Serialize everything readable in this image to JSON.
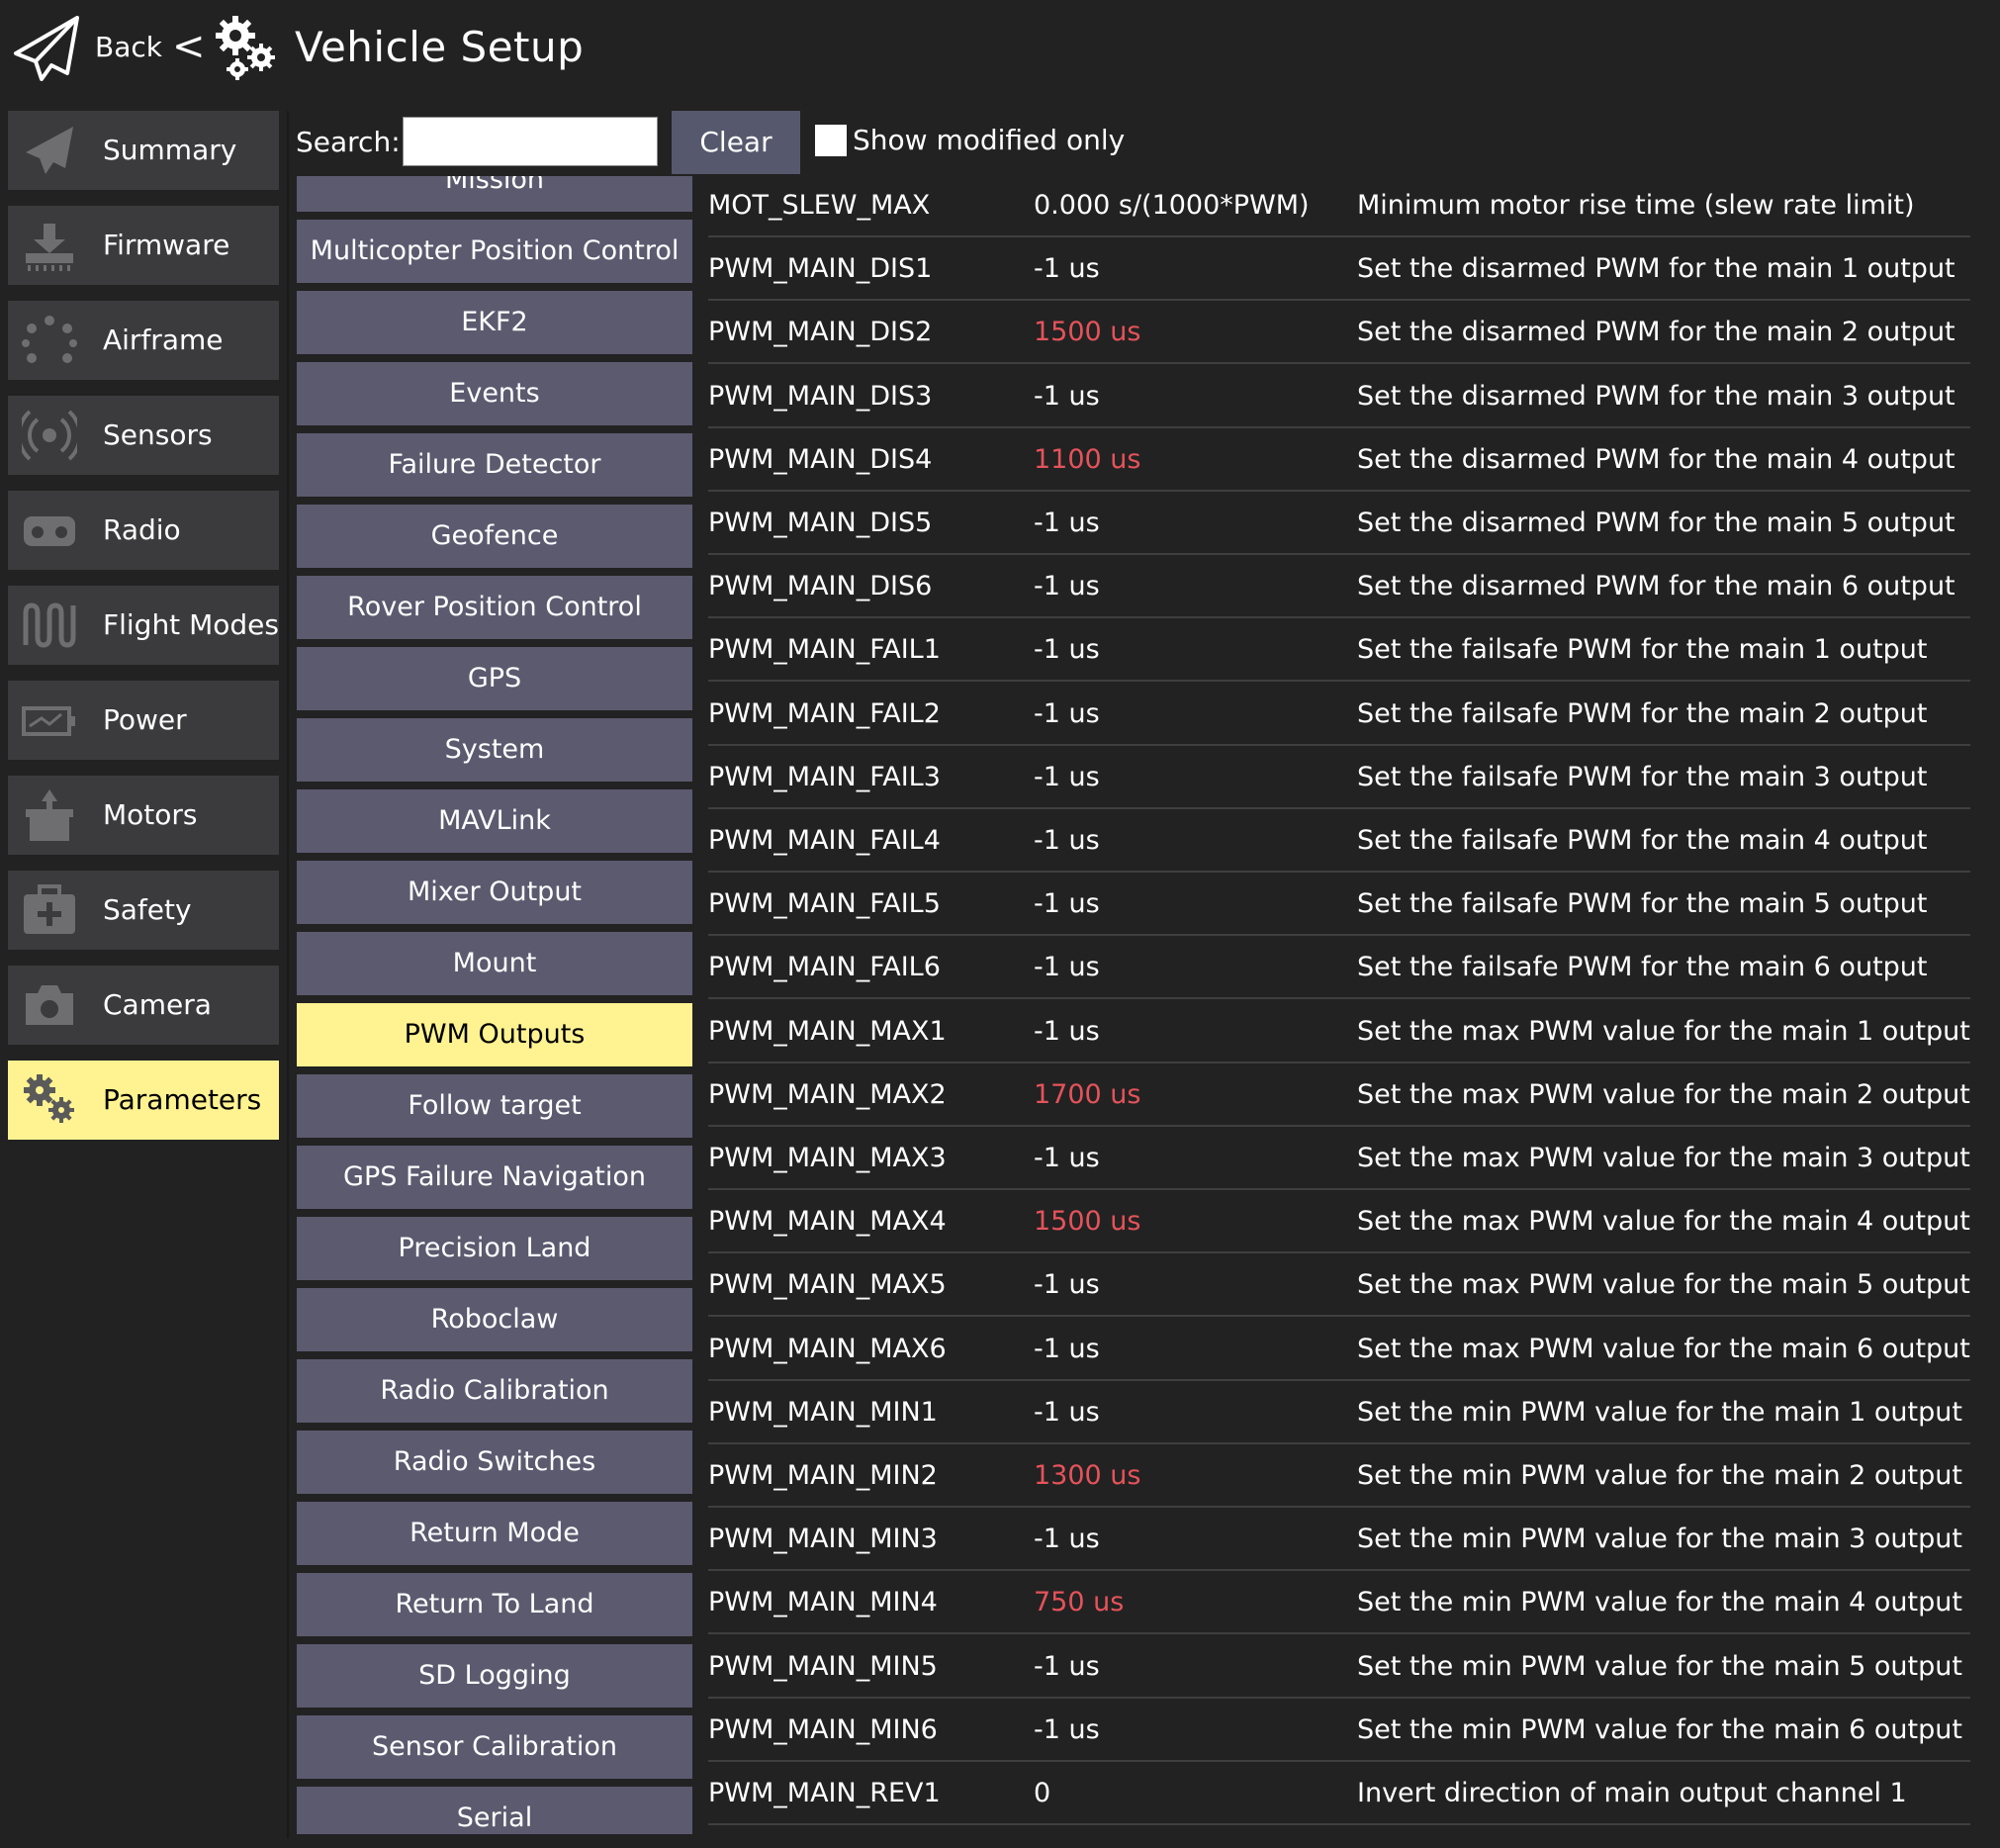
{
  "header": {
    "back_label": "Back",
    "separator": "<",
    "title": "Vehicle Setup"
  },
  "sidebar": {
    "items": [
      {
        "label": "Summary",
        "icon": "paper-plane-icon",
        "active": false
      },
      {
        "label": "Firmware",
        "icon": "download-chip-icon",
        "active": false
      },
      {
        "label": "Airframe",
        "icon": "airframe-dots-icon",
        "active": false
      },
      {
        "label": "Sensors",
        "icon": "radio-waves-icon",
        "active": false
      },
      {
        "label": "Radio",
        "icon": "transmitter-icon",
        "active": false
      },
      {
        "label": "Flight Modes",
        "icon": "waveform-icon",
        "active": false
      },
      {
        "label": "Power",
        "icon": "battery-icon",
        "active": false
      },
      {
        "label": "Motors",
        "icon": "motor-icon",
        "active": false
      },
      {
        "label": "Safety",
        "icon": "first-aid-icon",
        "active": false
      },
      {
        "label": "Camera",
        "icon": "camera-icon",
        "active": false
      },
      {
        "label": "Parameters",
        "icon": "gears-icon",
        "active": true
      }
    ]
  },
  "search": {
    "label": "Search:",
    "value": "",
    "clear_label": "Clear",
    "show_modified_label": "Show modified only",
    "show_modified_checked": false
  },
  "groups": [
    {
      "label": "Mission",
      "active": false
    },
    {
      "label": "Multicopter Position Control",
      "active": false
    },
    {
      "label": "EKF2",
      "active": false
    },
    {
      "label": "Events",
      "active": false
    },
    {
      "label": "Failure Detector",
      "active": false
    },
    {
      "label": "Geofence",
      "active": false
    },
    {
      "label": "Rover Position Control",
      "active": false
    },
    {
      "label": "GPS",
      "active": false
    },
    {
      "label": "System",
      "active": false
    },
    {
      "label": "MAVLink",
      "active": false
    },
    {
      "label": "Mixer Output",
      "active": false
    },
    {
      "label": "Mount",
      "active": false
    },
    {
      "label": "PWM Outputs",
      "active": true
    },
    {
      "label": "Follow target",
      "active": false
    },
    {
      "label": "GPS Failure Navigation",
      "active": false
    },
    {
      "label": "Precision Land",
      "active": false
    },
    {
      "label": "Roboclaw",
      "active": false
    },
    {
      "label": "Radio Calibration",
      "active": false
    },
    {
      "label": "Radio Switches",
      "active": false
    },
    {
      "label": "Return Mode",
      "active": false
    },
    {
      "label": "Return To Land",
      "active": false
    },
    {
      "label": "SD Logging",
      "active": false
    },
    {
      "label": "Sensor Calibration",
      "active": false
    },
    {
      "label": "Serial",
      "active": false
    }
  ],
  "params": [
    {
      "name": "MOT_SLEW_MAX",
      "value": "0.000 s/(1000*PWM)",
      "desc": "Minimum motor rise time (slew rate limit)",
      "modified": false
    },
    {
      "name": "PWM_MAIN_DIS1",
      "value": "-1 us",
      "desc": "Set the disarmed PWM for the main 1 output",
      "modified": false
    },
    {
      "name": "PWM_MAIN_DIS2",
      "value": "1500 us",
      "desc": "Set the disarmed PWM for the main 2 output",
      "modified": true
    },
    {
      "name": "PWM_MAIN_DIS3",
      "value": "-1 us",
      "desc": "Set the disarmed PWM for the main 3 output",
      "modified": false
    },
    {
      "name": "PWM_MAIN_DIS4",
      "value": "1100 us",
      "desc": "Set the disarmed PWM for the main 4 output",
      "modified": true
    },
    {
      "name": "PWM_MAIN_DIS5",
      "value": "-1 us",
      "desc": "Set the disarmed PWM for the main 5 output",
      "modified": false
    },
    {
      "name": "PWM_MAIN_DIS6",
      "value": "-1 us",
      "desc": "Set the disarmed PWM for the main 6 output",
      "modified": false
    },
    {
      "name": "PWM_MAIN_FAIL1",
      "value": "-1 us",
      "desc": "Set the failsafe PWM for the main 1 output",
      "modified": false
    },
    {
      "name": "PWM_MAIN_FAIL2",
      "value": "-1 us",
      "desc": "Set the failsafe PWM for the main 2 output",
      "modified": false
    },
    {
      "name": "PWM_MAIN_FAIL3",
      "value": "-1 us",
      "desc": "Set the failsafe PWM for the main 3 output",
      "modified": false
    },
    {
      "name": "PWM_MAIN_FAIL4",
      "value": "-1 us",
      "desc": "Set the failsafe PWM for the main 4 output",
      "modified": false
    },
    {
      "name": "PWM_MAIN_FAIL5",
      "value": "-1 us",
      "desc": "Set the failsafe PWM for the main 5 output",
      "modified": false
    },
    {
      "name": "PWM_MAIN_FAIL6",
      "value": "-1 us",
      "desc": "Set the failsafe PWM for the main 6 output",
      "modified": false
    },
    {
      "name": "PWM_MAIN_MAX1",
      "value": "-1 us",
      "desc": "Set the max PWM value for the main 1 output",
      "modified": false
    },
    {
      "name": "PWM_MAIN_MAX2",
      "value": "1700 us",
      "desc": "Set the max PWM value for the main 2 output",
      "modified": true
    },
    {
      "name": "PWM_MAIN_MAX3",
      "value": "-1 us",
      "desc": "Set the max PWM value for the main 3 output",
      "modified": false
    },
    {
      "name": "PWM_MAIN_MAX4",
      "value": "1500 us",
      "desc": "Set the max PWM value for the main 4 output",
      "modified": true
    },
    {
      "name": "PWM_MAIN_MAX5",
      "value": "-1 us",
      "desc": "Set the max PWM value for the main 5 output",
      "modified": false
    },
    {
      "name": "PWM_MAIN_MAX6",
      "value": "-1 us",
      "desc": "Set the max PWM value for the main 6 output",
      "modified": false
    },
    {
      "name": "PWM_MAIN_MIN1",
      "value": "-1 us",
      "desc": "Set the min PWM value for the main 1 output",
      "modified": false
    },
    {
      "name": "PWM_MAIN_MIN2",
      "value": "1300 us",
      "desc": "Set the min PWM value for the main 2 output",
      "modified": true
    },
    {
      "name": "PWM_MAIN_MIN3",
      "value": "-1 us",
      "desc": "Set the min PWM value for the main 3 output",
      "modified": false
    },
    {
      "name": "PWM_MAIN_MIN4",
      "value": "750 us",
      "desc": "Set the min PWM value for the main 4 output",
      "modified": true
    },
    {
      "name": "PWM_MAIN_MIN5",
      "value": "-1 us",
      "desc": "Set the min PWM value for the main 5 output",
      "modified": false
    },
    {
      "name": "PWM_MAIN_MIN6",
      "value": "-1 us",
      "desc": "Set the min PWM value for the main 6 output",
      "modified": false
    },
    {
      "name": "PWM_MAIN_REV1",
      "value": "0",
      "desc": "Invert direction of main output channel 1",
      "modified": false
    }
  ],
  "colors": {
    "background": "#222222",
    "sidebar_button": "#3b3b3d",
    "group_button": "#5b5a6f",
    "active_highlight": "#fff391",
    "modified_value": "#e5535b",
    "text": "#ffffff"
  }
}
